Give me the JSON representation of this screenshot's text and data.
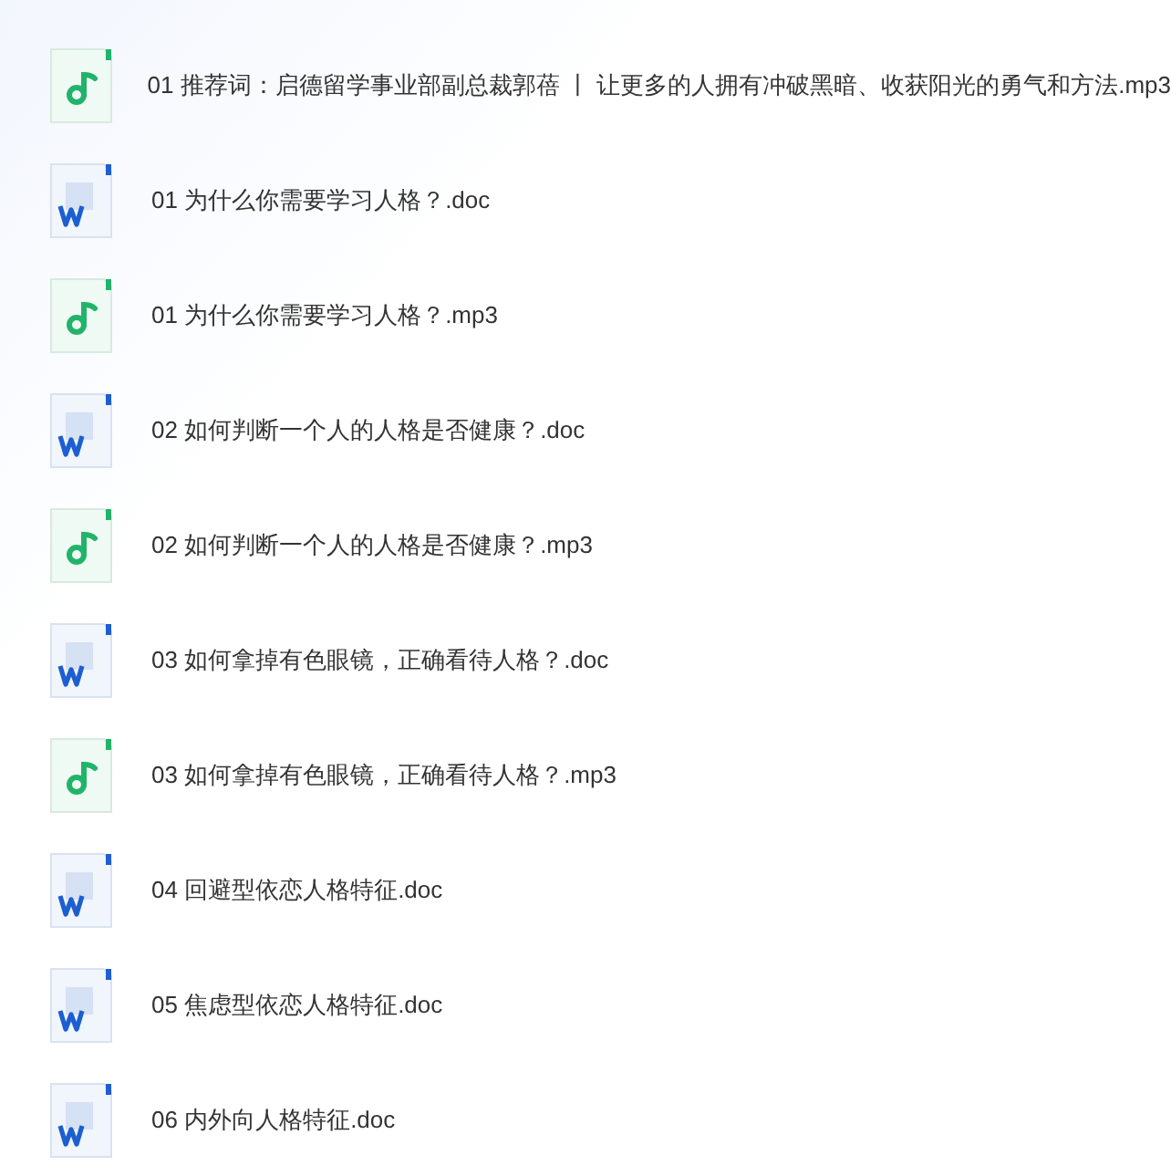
{
  "files": [
    {
      "kind": "audio",
      "name": "01 推荐词：启德留学事业部副总裁郭蓓 丨 让更多的人拥有冲破黑暗、收获阳光的勇气和方法.mp3"
    },
    {
      "kind": "word",
      "name": "01 为什么你需要学习人格？.doc"
    },
    {
      "kind": "audio",
      "name": "01 为什么你需要学习人格？.mp3"
    },
    {
      "kind": "word",
      "name": "02 如何判断一个人的人格是否健康？.doc"
    },
    {
      "kind": "audio",
      "name": "02 如何判断一个人的人格是否健康？.mp3"
    },
    {
      "kind": "word",
      "name": "03 如何拿掉有色眼镜，正确看待人格？.doc"
    },
    {
      "kind": "audio",
      "name": "03 如何拿掉有色眼镜，正确看待人格？.mp3"
    },
    {
      "kind": "word",
      "name": "04 回避型依恋人格特征.doc"
    },
    {
      "kind": "word",
      "name": "05 焦虑型依恋人格特征.doc"
    },
    {
      "kind": "word",
      "name": "06 内外向人格特征.doc"
    }
  ]
}
